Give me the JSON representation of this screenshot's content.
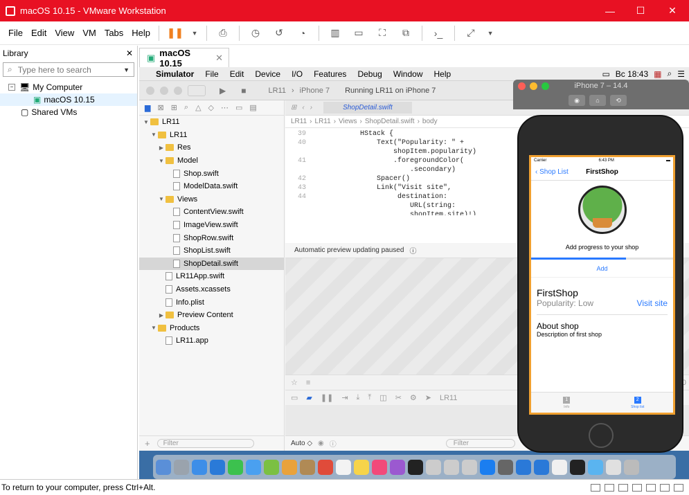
{
  "window": {
    "title": "macOS 10.15 - VMware Workstation",
    "min": "—",
    "max": "☐",
    "close": "✕"
  },
  "menu": [
    "File",
    "Edit",
    "View",
    "VM",
    "Tabs",
    "Help"
  ],
  "library": {
    "title": "Library",
    "search_placeholder": "Type here to search",
    "items": [
      {
        "label": "My Computer",
        "box": "−"
      },
      {
        "label": "macOS 10.15"
      },
      {
        "label": "Shared VMs"
      }
    ]
  },
  "vm_tab": {
    "label": "macOS 10.15",
    "close": "✕"
  },
  "mac_menu": {
    "apple": "",
    "items": [
      "Simulator",
      "File",
      "Edit",
      "Device",
      "I/O",
      "Features",
      "Debug",
      "Window",
      "Help"
    ],
    "clock": "Вс 18:43"
  },
  "xcode": {
    "scheme_a": "LR11",
    "scheme_b": "iPhone 7",
    "status": "Running LR11 on iPhone 7",
    "editor_tab": "ShopDetail.swift",
    "breadcrumb": [
      "LR11",
      "LR11",
      "Views",
      "ShopDetail.swift",
      "body"
    ],
    "code_lines": [
      {
        "n": "39",
        "text": "            HStack {"
      },
      {
        "n": "40",
        "text": "                Text(\"Popularity: \" +"
      },
      {
        "n": "",
        "text": "                    shopItem.popularity)"
      },
      {
        "n": "41",
        "text": "                    .foregroundColor("
      },
      {
        "n": "",
        "text": "                        .secondary)"
      },
      {
        "n": "42",
        "text": "                Spacer()"
      },
      {
        "n": "43",
        "text": "                Link(\"Visit site\","
      },
      {
        "n": "44",
        "text": "                     destination:"
      },
      {
        "n": "",
        "text": "                        URL(string:"
      },
      {
        "n": "",
        "text": "                        shopItem.site)!)"
      }
    ],
    "preview_status": "Automatic preview updating paused",
    "bottom_auto": "Auto ◇",
    "filter": "Filter",
    "debug_target": "LR11",
    "zoom": "10"
  },
  "navigator": [
    {
      "label": "LR11",
      "depth": 0,
      "tri": "▼",
      "kind": "project"
    },
    {
      "label": "LR11",
      "depth": 1,
      "tri": "▼",
      "kind": "folder"
    },
    {
      "label": "Res",
      "depth": 2,
      "tri": "▶",
      "kind": "folder"
    },
    {
      "label": "Model",
      "depth": 2,
      "tri": "▼",
      "kind": "folder"
    },
    {
      "label": "Shop.swift",
      "depth": 3,
      "tri": "",
      "kind": "file"
    },
    {
      "label": "ModelData.swift",
      "depth": 3,
      "tri": "",
      "kind": "file"
    },
    {
      "label": "Views",
      "depth": 2,
      "tri": "▼",
      "kind": "folder"
    },
    {
      "label": "ContentView.swift",
      "depth": 3,
      "tri": "",
      "kind": "file"
    },
    {
      "label": "ImageView.swift",
      "depth": 3,
      "tri": "",
      "kind": "file"
    },
    {
      "label": "ShopRow.swift",
      "depth": 3,
      "tri": "",
      "kind": "file"
    },
    {
      "label": "ShopList.swift",
      "depth": 3,
      "tri": "",
      "kind": "file"
    },
    {
      "label": "ShopDetail.swift",
      "depth": 3,
      "tri": "",
      "kind": "file",
      "selected": true
    },
    {
      "label": "LR11App.swift",
      "depth": 2,
      "tri": "",
      "kind": "file"
    },
    {
      "label": "Assets.xcassets",
      "depth": 2,
      "tri": "",
      "kind": "file"
    },
    {
      "label": "Info.plist",
      "depth": 2,
      "tri": "",
      "kind": "file"
    },
    {
      "label": "Preview Content",
      "depth": 2,
      "tri": "▶",
      "kind": "folder"
    },
    {
      "label": "Products",
      "depth": 1,
      "tri": "▼",
      "kind": "folder"
    },
    {
      "label": "LR11.app",
      "depth": 2,
      "tri": "",
      "kind": "file"
    }
  ],
  "simulator": {
    "title": "iPhone 7 – 14.4",
    "carrier": "Carrier",
    "time": "6:43 PM",
    "back": "Shop List",
    "nav_title": "FirstShop",
    "progress_label": "Add progress to your shop",
    "progress": 0.67,
    "add": "Add",
    "shop_name": "FirstShop",
    "popularity": "Popularity: Low",
    "visit": "Visit site",
    "about": "About shop",
    "description": "Description of first shop",
    "tabs": [
      {
        "label": "Info",
        "num": "1"
      },
      {
        "label": "Shop list",
        "num": "2"
      }
    ]
  },
  "status_bar": {
    "text": "To return to your computer, press Ctrl+Alt."
  },
  "colors": {
    "title_bar": "#e81123",
    "accent": "#2979ff",
    "phone_border": "#f0a030"
  }
}
